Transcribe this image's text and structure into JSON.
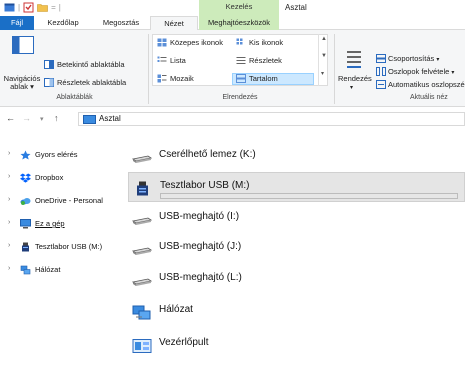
{
  "window": {
    "title": "Asztal",
    "contextual_tab_group": "Kezelés"
  },
  "tabs": [
    {
      "label": "Fájl"
    },
    {
      "label": "Kezdőlap"
    },
    {
      "label": "Megosztás"
    },
    {
      "label": "Nézet"
    },
    {
      "label": "Meghajtóeszközök"
    }
  ],
  "ribbon": {
    "panes": {
      "navigation_pane": "Navigációs ablak",
      "navigation_pane_dropdown": "▾",
      "preview_pane": "Betekintő ablaktábla",
      "details_pane": "Részletek ablaktábla",
      "group_label": "Ablaktáblák"
    },
    "layout": {
      "items": [
        "Közepes ikonok",
        "Kis ikonok",
        "Lista",
        "Részletek",
        "Mozaik",
        "Tartalom"
      ],
      "selected": "Tartalom",
      "group_label": "Elrendezés"
    },
    "current_view": {
      "sort": "Rendezés",
      "group_by": "Csoportosítás",
      "add_columns": "Oszlopok felvétele",
      "autosize": "Automatikus oszlopszé",
      "group_label": "Aktuális néz"
    }
  },
  "address_bar": {
    "path": "Asztal"
  },
  "nav_pane": {
    "items": [
      {
        "label": "Gyors elérés",
        "icon": "star-icon"
      },
      {
        "label": "Dropbox",
        "icon": "dropbox-icon"
      },
      {
        "label": "OneDrive - Personal",
        "icon": "onedrive-icon"
      },
      {
        "label": "Ez a gép",
        "icon": "computer-icon"
      },
      {
        "label": "Tesztlabor USB (M:)",
        "icon": "usb-icon"
      },
      {
        "label": "Hálózat",
        "icon": "network-icon"
      }
    ]
  },
  "content": {
    "items": [
      {
        "name": "Cserélhető lemez (K:)",
        "icon": "drive-icon",
        "selected": false,
        "usage_fraction": null
      },
      {
        "name": "Tesztlabor USB (M:)",
        "icon": "usb-icon",
        "selected": true,
        "usage_fraction": 0.0
      },
      {
        "name": "USB-meghajtó (I:)",
        "icon": "drive-icon",
        "selected": false,
        "usage_fraction": null
      },
      {
        "name": "USB-meghajtó (J:)",
        "icon": "drive-icon",
        "selected": false,
        "usage_fraction": null
      },
      {
        "name": "USB-meghajtó (L:)",
        "icon": "drive-icon",
        "selected": false,
        "usage_fraction": null
      },
      {
        "name": "Hálózat",
        "icon": "network-icon",
        "selected": false,
        "usage_fraction": null
      },
      {
        "name": "Vezérlőpult",
        "icon": "control-panel-icon",
        "selected": false,
        "usage_fraction": null
      }
    ]
  },
  "colors": {
    "accent": "#1a6fc7",
    "contextual_tab": "#cdebbb",
    "selection": "#cce8ff",
    "progress": "#26a0da"
  }
}
